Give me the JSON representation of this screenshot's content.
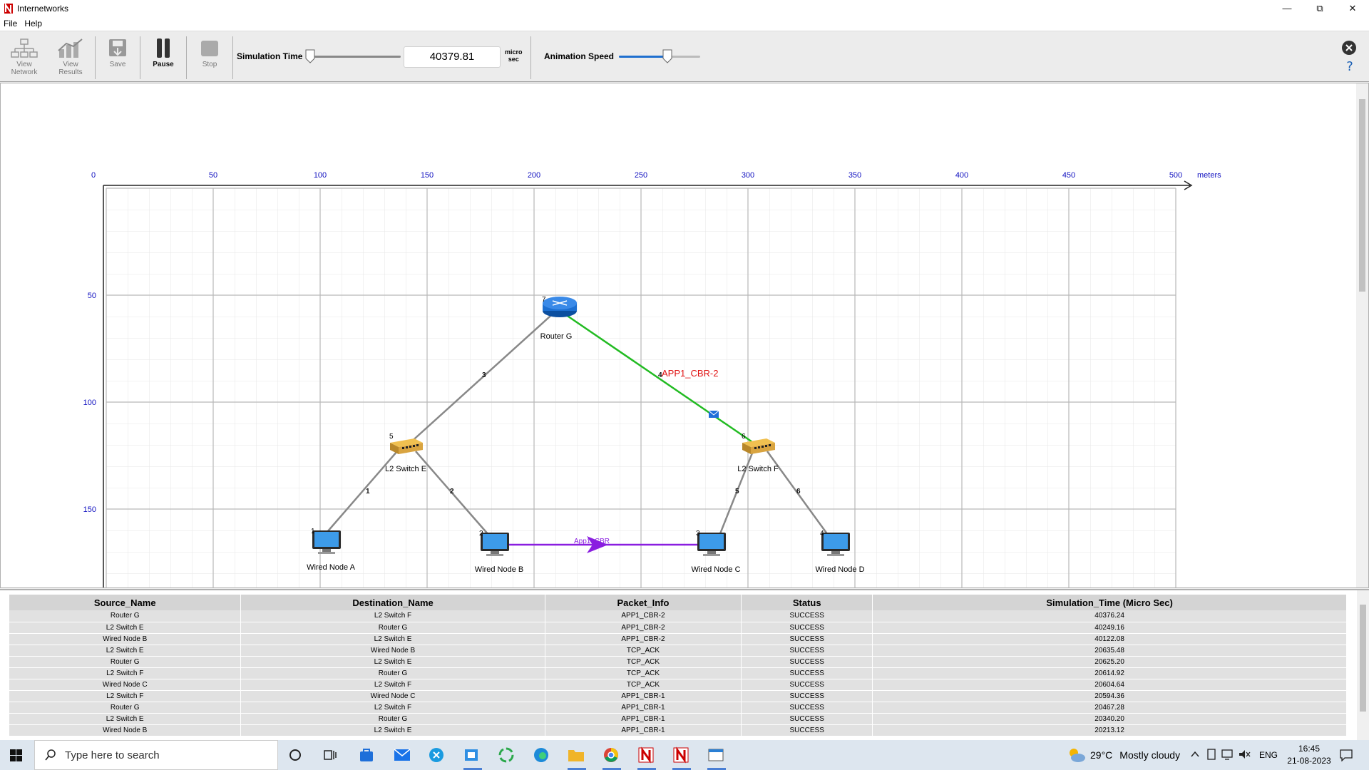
{
  "window": {
    "title": "Internetworks"
  },
  "menu": [
    "File",
    "Help"
  ],
  "toolbar": {
    "view_network": "View\nNetwork",
    "view_results": "View\nResults",
    "save": "Save",
    "pause": "Pause",
    "stop": "Stop",
    "sim_time_label": "Simulation Time",
    "sim_time_value": "40379.81",
    "sim_time_unit": "micro\nsec",
    "anim_speed_label": "Animation Speed",
    "anim_speed_level": 0.6
  },
  "grid": {
    "x_ticks": [
      "0",
      "50",
      "100",
      "150",
      "200",
      "250",
      "300",
      "350",
      "400",
      "450",
      "500"
    ],
    "x_unit": "meters",
    "y_ticks": [
      "50",
      "100",
      "150"
    ]
  },
  "nodes": [
    {
      "id": "router-g",
      "label": "Router G",
      "num": "7",
      "type": "router"
    },
    {
      "id": "switch-e",
      "label": "L2 Switch E",
      "num": "5",
      "type": "switch"
    },
    {
      "id": "switch-f",
      "label": "L2 Switch F",
      "num": "6",
      "type": "switch"
    },
    {
      "id": "node-a",
      "label": "Wired Node A",
      "num": "1",
      "type": "pc"
    },
    {
      "id": "node-b",
      "label": "Wired Node B",
      "num": "2",
      "type": "pc"
    },
    {
      "id": "node-c",
      "label": "Wired Node C",
      "num": "3",
      "type": "pc"
    },
    {
      "id": "node-d",
      "label": "Wired Node D",
      "num": "4",
      "type": "pc"
    }
  ],
  "links": [
    {
      "num": "1"
    },
    {
      "num": "2"
    },
    {
      "num": "3"
    },
    {
      "num": "4"
    },
    {
      "num": "5"
    },
    {
      "num": "6"
    }
  ],
  "animation": {
    "packet_label": "APP1_CBR-2",
    "app_label": "App1_CBR"
  },
  "table": {
    "columns": [
      "Source_Name",
      "Destination_Name",
      "Packet_Info",
      "Status",
      "Simulation_Time (Micro Sec)"
    ],
    "rows": [
      [
        "Router G",
        "L2 Switch F",
        "APP1_CBR-2",
        "SUCCESS",
        "40376.24"
      ],
      [
        "L2 Switch E",
        "Router G",
        "APP1_CBR-2",
        "SUCCESS",
        "40249.16"
      ],
      [
        "Wired Node B",
        "L2 Switch E",
        "APP1_CBR-2",
        "SUCCESS",
        "40122.08"
      ],
      [
        "L2 Switch E",
        "Wired Node B",
        "TCP_ACK",
        "SUCCESS",
        "20635.48"
      ],
      [
        "Router G",
        "L2 Switch E",
        "TCP_ACK",
        "SUCCESS",
        "20625.20"
      ],
      [
        "L2 Switch F",
        "Router G",
        "TCP_ACK",
        "SUCCESS",
        "20614.92"
      ],
      [
        "Wired Node C",
        "L2 Switch F",
        "TCP_ACK",
        "SUCCESS",
        "20604.64"
      ],
      [
        "L2 Switch F",
        "Wired Node C",
        "APP1_CBR-1",
        "SUCCESS",
        "20594.36"
      ],
      [
        "Router G",
        "L2 Switch F",
        "APP1_CBR-1",
        "SUCCESS",
        "20467.28"
      ],
      [
        "L2 Switch E",
        "Router G",
        "APP1_CBR-1",
        "SUCCESS",
        "20340.20"
      ],
      [
        "Wired Node B",
        "L2 Switch E",
        "APP1_CBR-1",
        "SUCCESS",
        "20213.12"
      ]
    ]
  },
  "taskbar": {
    "search_placeholder": "Type here to search",
    "weather_temp": "29°C",
    "weather_text": "Mostly cloudy",
    "lang": "ENG",
    "time": "16:45",
    "date": "21-08-2023"
  }
}
